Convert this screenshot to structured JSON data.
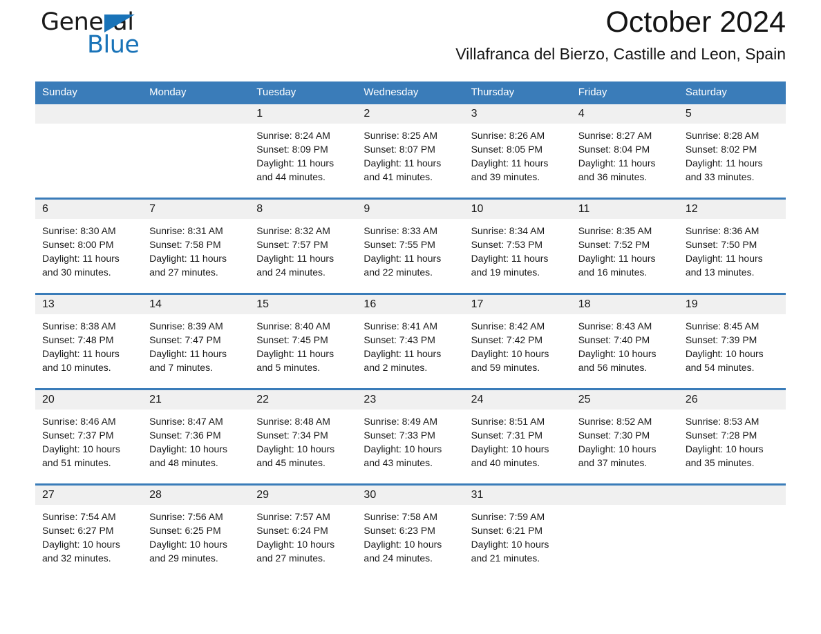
{
  "brand": {
    "name_top": "General",
    "name_bottom": "Blue",
    "triangle_color": "#1973b8",
    "text_color": "#1a1a1a"
  },
  "header": {
    "month_title": "October 2024",
    "location": "Villafranca del Bierzo, Castille and Leon, Spain"
  },
  "theme": {
    "accent": "#3a7cb9",
    "daynum_band": "#f0f0f0",
    "page_background": "#ffffff",
    "text": "#1a1a1a"
  },
  "calendar": {
    "weekday_headers": [
      "Sunday",
      "Monday",
      "Tuesday",
      "Wednesday",
      "Thursday",
      "Friday",
      "Saturday"
    ],
    "weeks": [
      [
        {
          "day": "",
          "sunrise": "",
          "sunset": "",
          "daylight": ""
        },
        {
          "day": "",
          "sunrise": "",
          "sunset": "",
          "daylight": ""
        },
        {
          "day": "1",
          "sunrise": "Sunrise: 8:24 AM",
          "sunset": "Sunset: 8:09 PM",
          "daylight": "Daylight: 11 hours and 44 minutes."
        },
        {
          "day": "2",
          "sunrise": "Sunrise: 8:25 AM",
          "sunset": "Sunset: 8:07 PM",
          "daylight": "Daylight: 11 hours and 41 minutes."
        },
        {
          "day": "3",
          "sunrise": "Sunrise: 8:26 AM",
          "sunset": "Sunset: 8:05 PM",
          "daylight": "Daylight: 11 hours and 39 minutes."
        },
        {
          "day": "4",
          "sunrise": "Sunrise: 8:27 AM",
          "sunset": "Sunset: 8:04 PM",
          "daylight": "Daylight: 11 hours and 36 minutes."
        },
        {
          "day": "5",
          "sunrise": "Sunrise: 8:28 AM",
          "sunset": "Sunset: 8:02 PM",
          "daylight": "Daylight: 11 hours and 33 minutes."
        }
      ],
      [
        {
          "day": "6",
          "sunrise": "Sunrise: 8:30 AM",
          "sunset": "Sunset: 8:00 PM",
          "daylight": "Daylight: 11 hours and 30 minutes."
        },
        {
          "day": "7",
          "sunrise": "Sunrise: 8:31 AM",
          "sunset": "Sunset: 7:58 PM",
          "daylight": "Daylight: 11 hours and 27 minutes."
        },
        {
          "day": "8",
          "sunrise": "Sunrise: 8:32 AM",
          "sunset": "Sunset: 7:57 PM",
          "daylight": "Daylight: 11 hours and 24 minutes."
        },
        {
          "day": "9",
          "sunrise": "Sunrise: 8:33 AM",
          "sunset": "Sunset: 7:55 PM",
          "daylight": "Daylight: 11 hours and 22 minutes."
        },
        {
          "day": "10",
          "sunrise": "Sunrise: 8:34 AM",
          "sunset": "Sunset: 7:53 PM",
          "daylight": "Daylight: 11 hours and 19 minutes."
        },
        {
          "day": "11",
          "sunrise": "Sunrise: 8:35 AM",
          "sunset": "Sunset: 7:52 PM",
          "daylight": "Daylight: 11 hours and 16 minutes."
        },
        {
          "day": "12",
          "sunrise": "Sunrise: 8:36 AM",
          "sunset": "Sunset: 7:50 PM",
          "daylight": "Daylight: 11 hours and 13 minutes."
        }
      ],
      [
        {
          "day": "13",
          "sunrise": "Sunrise: 8:38 AM",
          "sunset": "Sunset: 7:48 PM",
          "daylight": "Daylight: 11 hours and 10 minutes."
        },
        {
          "day": "14",
          "sunrise": "Sunrise: 8:39 AM",
          "sunset": "Sunset: 7:47 PM",
          "daylight": "Daylight: 11 hours and 7 minutes."
        },
        {
          "day": "15",
          "sunrise": "Sunrise: 8:40 AM",
          "sunset": "Sunset: 7:45 PM",
          "daylight": "Daylight: 11 hours and 5 minutes."
        },
        {
          "day": "16",
          "sunrise": "Sunrise: 8:41 AM",
          "sunset": "Sunset: 7:43 PM",
          "daylight": "Daylight: 11 hours and 2 minutes."
        },
        {
          "day": "17",
          "sunrise": "Sunrise: 8:42 AM",
          "sunset": "Sunset: 7:42 PM",
          "daylight": "Daylight: 10 hours and 59 minutes."
        },
        {
          "day": "18",
          "sunrise": "Sunrise: 8:43 AM",
          "sunset": "Sunset: 7:40 PM",
          "daylight": "Daylight: 10 hours and 56 minutes."
        },
        {
          "day": "19",
          "sunrise": "Sunrise: 8:45 AM",
          "sunset": "Sunset: 7:39 PM",
          "daylight": "Daylight: 10 hours and 54 minutes."
        }
      ],
      [
        {
          "day": "20",
          "sunrise": "Sunrise: 8:46 AM",
          "sunset": "Sunset: 7:37 PM",
          "daylight": "Daylight: 10 hours and 51 minutes."
        },
        {
          "day": "21",
          "sunrise": "Sunrise: 8:47 AM",
          "sunset": "Sunset: 7:36 PM",
          "daylight": "Daylight: 10 hours and 48 minutes."
        },
        {
          "day": "22",
          "sunrise": "Sunrise: 8:48 AM",
          "sunset": "Sunset: 7:34 PM",
          "daylight": "Daylight: 10 hours and 45 minutes."
        },
        {
          "day": "23",
          "sunrise": "Sunrise: 8:49 AM",
          "sunset": "Sunset: 7:33 PM",
          "daylight": "Daylight: 10 hours and 43 minutes."
        },
        {
          "day": "24",
          "sunrise": "Sunrise: 8:51 AM",
          "sunset": "Sunset: 7:31 PM",
          "daylight": "Daylight: 10 hours and 40 minutes."
        },
        {
          "day": "25",
          "sunrise": "Sunrise: 8:52 AM",
          "sunset": "Sunset: 7:30 PM",
          "daylight": "Daylight: 10 hours and 37 minutes."
        },
        {
          "day": "26",
          "sunrise": "Sunrise: 8:53 AM",
          "sunset": "Sunset: 7:28 PM",
          "daylight": "Daylight: 10 hours and 35 minutes."
        }
      ],
      [
        {
          "day": "27",
          "sunrise": "Sunrise: 7:54 AM",
          "sunset": "Sunset: 6:27 PM",
          "daylight": "Daylight: 10 hours and 32 minutes."
        },
        {
          "day": "28",
          "sunrise": "Sunrise: 7:56 AM",
          "sunset": "Sunset: 6:25 PM",
          "daylight": "Daylight: 10 hours and 29 minutes."
        },
        {
          "day": "29",
          "sunrise": "Sunrise: 7:57 AM",
          "sunset": "Sunset: 6:24 PM",
          "daylight": "Daylight: 10 hours and 27 minutes."
        },
        {
          "day": "30",
          "sunrise": "Sunrise: 7:58 AM",
          "sunset": "Sunset: 6:23 PM",
          "daylight": "Daylight: 10 hours and 24 minutes."
        },
        {
          "day": "31",
          "sunrise": "Sunrise: 7:59 AM",
          "sunset": "Sunset: 6:21 PM",
          "daylight": "Daylight: 10 hours and 21 minutes."
        },
        {
          "day": "",
          "sunrise": "",
          "sunset": "",
          "daylight": ""
        },
        {
          "day": "",
          "sunrise": "",
          "sunset": "",
          "daylight": ""
        }
      ]
    ]
  }
}
